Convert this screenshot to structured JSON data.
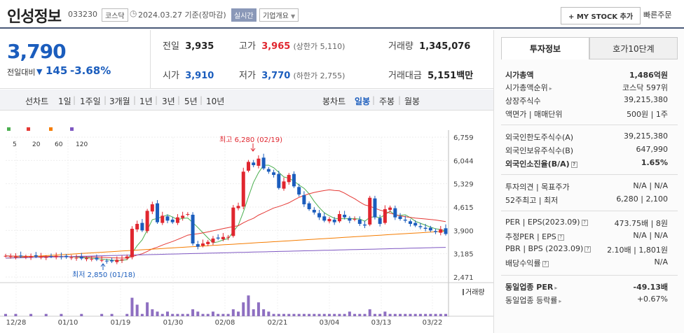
{
  "header": {
    "name": "인성정보",
    "code": "033230",
    "market": "코스닥",
    "date_text": "2024.03.27 기준(장마감)",
    "realtime_label": "실시간",
    "company_overview_label": "기업개요",
    "mystock_label": "+ MY STOCK 추가",
    "quick_order_label": "빠른주문"
  },
  "summary": {
    "current_price": "3,790",
    "prev_compare_label": "전일대비",
    "change": "145",
    "change_pct": "-3.68%",
    "prev_close_label": "전일",
    "prev_close": "3,935",
    "open_label": "시가",
    "open": "3,910",
    "high_label": "고가",
    "high": "3,965",
    "upper_limit_text": "(상한가 5,110)",
    "low_label": "저가",
    "low": "3,770",
    "lower_limit_text": "(하한가 2,755)",
    "volume_label": "거래량",
    "volume": "1,345,076",
    "amount_label": "거래대금",
    "amount": "5,151",
    "amount_unit": "백만"
  },
  "toolbar": {
    "line_label": "선차트",
    "periods": [
      "1일",
      "1주일",
      "3개월",
      "1년",
      "3년",
      "5년",
      "10년"
    ],
    "candle_label": "봉차트",
    "candles": [
      "일봉",
      "주봉",
      "월봉"
    ],
    "active_candle": "일봉"
  },
  "chart_data": {
    "type": "candlestick",
    "legend": [
      {
        "name": "5",
        "color": "#4caf50"
      },
      {
        "name": "20",
        "color": "#e53935"
      },
      {
        "name": "60",
        "color": "#f57c00"
      },
      {
        "name": "120",
        "color": "#7e57c2"
      }
    ],
    "y_ticks": [
      "6,759",
      "6,044",
      "5,329",
      "4,615",
      "3,900",
      "3,185",
      "2,471"
    ],
    "y_range": [
      2471,
      6759
    ],
    "x_ticks": [
      "12/28",
      "01/10",
      "01/19",
      "01/30",
      "02/08",
      "02/21",
      "03/04",
      "03/13",
      "03/22"
    ],
    "high_annotation": "최고 6,280 (02/19)",
    "low_annotation": "최저 2,850 (01/18)",
    "volume_label": "거래량",
    "up_color": "#e0262f",
    "down_color": "#1b5dbd",
    "volume_color": "#8e6fc1"
  },
  "panel": {
    "tab_active": "투자정보",
    "tab_other": "호가10단계",
    "market_cap_label": "시가총액",
    "market_cap": "1,486억원",
    "market_cap_rank_label": "시가총액순위",
    "market_cap_rank": "코스닥 597위",
    "shares_label": "상장주식수",
    "shares": "39,215,380",
    "face_label": "액면가 | 매매단위",
    "face": "500원 | 1주",
    "foreign_limit_label": "외국인한도주식수(A)",
    "foreign_limit": "39,215,380",
    "foreign_hold_label": "외국인보유주식수(B)",
    "foreign_hold": "647,990",
    "foreign_ratio_label": "외국인소진율(B/A)",
    "foreign_ratio": "1.65%",
    "opinion_label": "투자의견 | 목표주가",
    "opinion": "N/A | N/A",
    "week52_label": "52주최고 | 최저",
    "week52": "6,280 | 2,100",
    "per_label": "PER | EPS(2023.09)",
    "per": "473.75배 | 8원",
    "est_per_label": "추정PER | EPS",
    "est_per": "N/A | N/A",
    "pbr_label": "PBR | BPS (2023.09)",
    "pbr": "2.10배 | 1,801원",
    "div_label": "배당수익률",
    "div": "N/A",
    "ind_per_label": "동일업종 PER",
    "ind_per": "-49.13배",
    "ind_rate_label": "동일업종 등락률",
    "ind_rate": "+0.67%"
  }
}
